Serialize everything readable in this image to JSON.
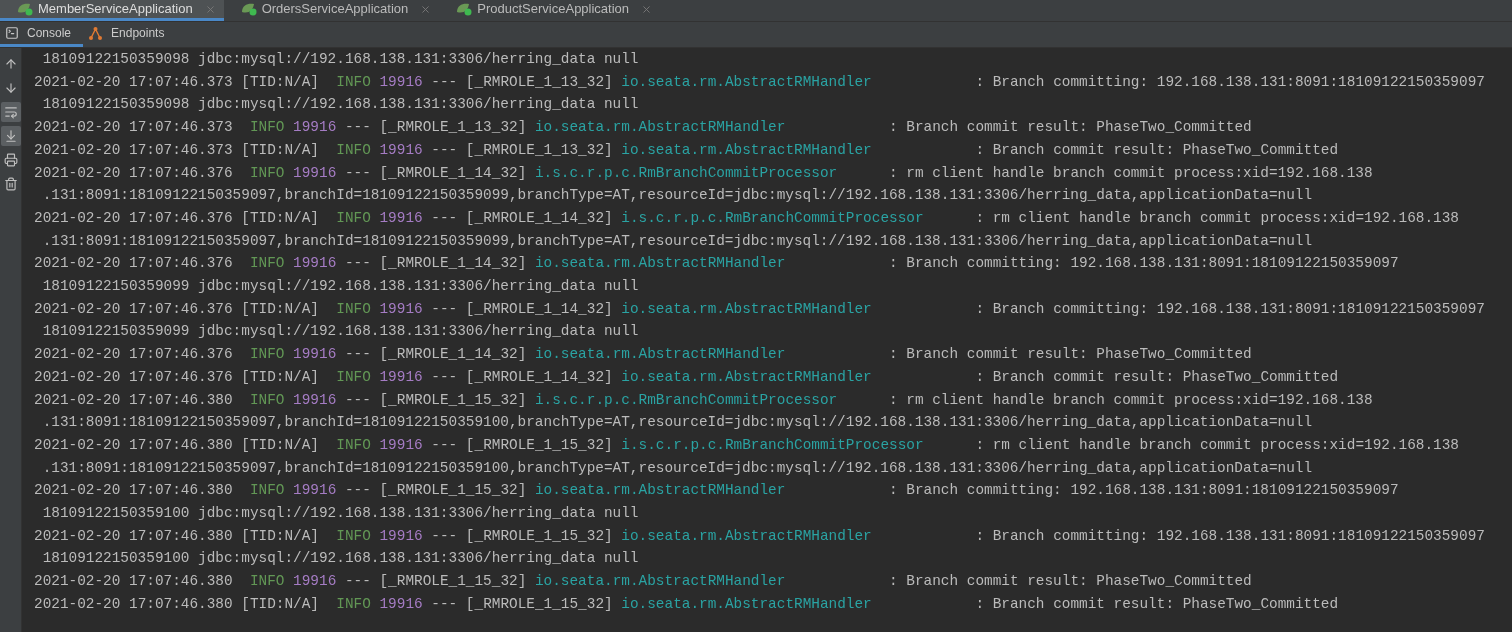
{
  "tabs": [
    {
      "label": "MemberServiceApplication",
      "selected": true
    },
    {
      "label": "OrdersServiceApplication",
      "selected": false
    },
    {
      "label": "ProductServiceApplication",
      "selected": false
    }
  ],
  "tool_tabs": [
    {
      "label": "Console",
      "kind": "console",
      "selected": true
    },
    {
      "label": "Endpoints",
      "kind": "endpoints",
      "selected": false
    }
  ],
  "side_toolbar": [
    {
      "kind": "up",
      "on": false
    },
    {
      "kind": "down",
      "on": false
    },
    {
      "kind": "wrap",
      "on": true
    },
    {
      "kind": "scroll-end",
      "on": true
    },
    {
      "kind": "print",
      "on": false
    },
    {
      "kind": "trash",
      "on": false
    }
  ],
  "log_lines": [
    {
      "kind": "cont",
      "text": "18109122150359098 jdbc:mysql://192.168.138.131:3306/herring_data null"
    },
    {
      "kind": "entry",
      "time": "2021-02-20 17:07:46.373",
      "tid": "[TID:N/A]",
      "level": "INFO",
      "pid": "19916",
      "sep": "---",
      "thread": "[_RMROLE_1_13_32]",
      "logger": "io.seata.rm.AbstractRMHandler",
      "message": ": Branch committing: 192.168.138.131:8091:18109122150359097"
    },
    {
      "kind": "cont",
      "text": "18109122150359098 jdbc:mysql://192.168.138.131:3306/herring_data null"
    },
    {
      "kind": "entry",
      "time": "2021-02-20 17:07:46.373",
      "level": "INFO",
      "pid": "19916",
      "sep": "---",
      "thread": "[_RMROLE_1_13_32]",
      "logger": "io.seata.rm.AbstractRMHandler",
      "message": ": Branch commit result: PhaseTwo_Committed"
    },
    {
      "kind": "entry",
      "time": "2021-02-20 17:07:46.373",
      "tid": "[TID:N/A]",
      "level": "INFO",
      "pid": "19916",
      "sep": "---",
      "thread": "[_RMROLE_1_13_32]",
      "logger": "io.seata.rm.AbstractRMHandler",
      "message": ": Branch commit result: PhaseTwo_Committed"
    },
    {
      "kind": "entry",
      "time": "2021-02-20 17:07:46.376",
      "level": "INFO",
      "pid": "19916",
      "sep": "---",
      "thread": "[_RMROLE_1_14_32]",
      "logger": "i.s.c.r.p.c.RmBranchCommitProcessor",
      "message": ": rm client handle branch commit process:xid=192.168.138"
    },
    {
      "kind": "cont",
      "text": ".131:8091:18109122150359097,branchId=18109122150359099,branchType=AT,resourceId=jdbc:mysql://192.168.138.131:3306/herring_data,applicationData=null"
    },
    {
      "kind": "entry",
      "time": "2021-02-20 17:07:46.376",
      "tid": "[TID:N/A]",
      "level": "INFO",
      "pid": "19916",
      "sep": "---",
      "thread": "[_RMROLE_1_14_32]",
      "logger": "i.s.c.r.p.c.RmBranchCommitProcessor",
      "message": ": rm client handle branch commit process:xid=192.168.138"
    },
    {
      "kind": "cont",
      "text": ".131:8091:18109122150359097,branchId=18109122150359099,branchType=AT,resourceId=jdbc:mysql://192.168.138.131:3306/herring_data,applicationData=null"
    },
    {
      "kind": "entry",
      "time": "2021-02-20 17:07:46.376",
      "level": "INFO",
      "pid": "19916",
      "sep": "---",
      "thread": "[_RMROLE_1_14_32]",
      "logger": "io.seata.rm.AbstractRMHandler",
      "message": ": Branch committing: 192.168.138.131:8091:18109122150359097"
    },
    {
      "kind": "cont",
      "text": "18109122150359099 jdbc:mysql://192.168.138.131:3306/herring_data null"
    },
    {
      "kind": "entry",
      "time": "2021-02-20 17:07:46.376",
      "tid": "[TID:N/A]",
      "level": "INFO",
      "pid": "19916",
      "sep": "---",
      "thread": "[_RMROLE_1_14_32]",
      "logger": "io.seata.rm.AbstractRMHandler",
      "message": ": Branch committing: 192.168.138.131:8091:18109122150359097"
    },
    {
      "kind": "cont",
      "text": "18109122150359099 jdbc:mysql://192.168.138.131:3306/herring_data null"
    },
    {
      "kind": "entry",
      "time": "2021-02-20 17:07:46.376",
      "level": "INFO",
      "pid": "19916",
      "sep": "---",
      "thread": "[_RMROLE_1_14_32]",
      "logger": "io.seata.rm.AbstractRMHandler",
      "message": ": Branch commit result: PhaseTwo_Committed"
    },
    {
      "kind": "entry",
      "time": "2021-02-20 17:07:46.376",
      "tid": "[TID:N/A]",
      "level": "INFO",
      "pid": "19916",
      "sep": "---",
      "thread": "[_RMROLE_1_14_32]",
      "logger": "io.seata.rm.AbstractRMHandler",
      "message": ": Branch commit result: PhaseTwo_Committed"
    },
    {
      "kind": "entry",
      "time": "2021-02-20 17:07:46.380",
      "level": "INFO",
      "pid": "19916",
      "sep": "---",
      "thread": "[_RMROLE_1_15_32]",
      "logger": "i.s.c.r.p.c.RmBranchCommitProcessor",
      "message": ": rm client handle branch commit process:xid=192.168.138"
    },
    {
      "kind": "cont",
      "text": ".131:8091:18109122150359097,branchId=18109122150359100,branchType=AT,resourceId=jdbc:mysql://192.168.138.131:3306/herring_data,applicationData=null"
    },
    {
      "kind": "entry",
      "time": "2021-02-20 17:07:46.380",
      "tid": "[TID:N/A]",
      "level": "INFO",
      "pid": "19916",
      "sep": "---",
      "thread": "[_RMROLE_1_15_32]",
      "logger": "i.s.c.r.p.c.RmBranchCommitProcessor",
      "message": ": rm client handle branch commit process:xid=192.168.138"
    },
    {
      "kind": "cont",
      "text": ".131:8091:18109122150359097,branchId=18109122150359100,branchType=AT,resourceId=jdbc:mysql://192.168.138.131:3306/herring_data,applicationData=null"
    },
    {
      "kind": "entry",
      "time": "2021-02-20 17:07:46.380",
      "level": "INFO",
      "pid": "19916",
      "sep": "---",
      "thread": "[_RMROLE_1_15_32]",
      "logger": "io.seata.rm.AbstractRMHandler",
      "message": ": Branch committing: 192.168.138.131:8091:18109122150359097"
    },
    {
      "kind": "cont",
      "text": "18109122150359100 jdbc:mysql://192.168.138.131:3306/herring_data null"
    },
    {
      "kind": "entry",
      "time": "2021-02-20 17:07:46.380",
      "tid": "[TID:N/A]",
      "level": "INFO",
      "pid": "19916",
      "sep": "---",
      "thread": "[_RMROLE_1_15_32]",
      "logger": "io.seata.rm.AbstractRMHandler",
      "message": ": Branch committing: 192.168.138.131:8091:18109122150359097"
    },
    {
      "kind": "cont",
      "text": "18109122150359100 jdbc:mysql://192.168.138.131:3306/herring_data null"
    },
    {
      "kind": "entry",
      "time": "2021-02-20 17:07:46.380",
      "level": "INFO",
      "pid": "19916",
      "sep": "---",
      "thread": "[_RMROLE_1_15_32]",
      "logger": "io.seata.rm.AbstractRMHandler",
      "message": ": Branch commit result: PhaseTwo_Committed"
    },
    {
      "kind": "entry",
      "time": "2021-02-20 17:07:46.380",
      "tid": "[TID:N/A]",
      "level": "INFO",
      "pid": "19916",
      "sep": "---",
      "thread": "[_RMROLE_1_15_32]",
      "logger": "io.seata.rm.AbstractRMHandler",
      "message": ": Branch commit result: PhaseTwo_Committed"
    }
  ]
}
